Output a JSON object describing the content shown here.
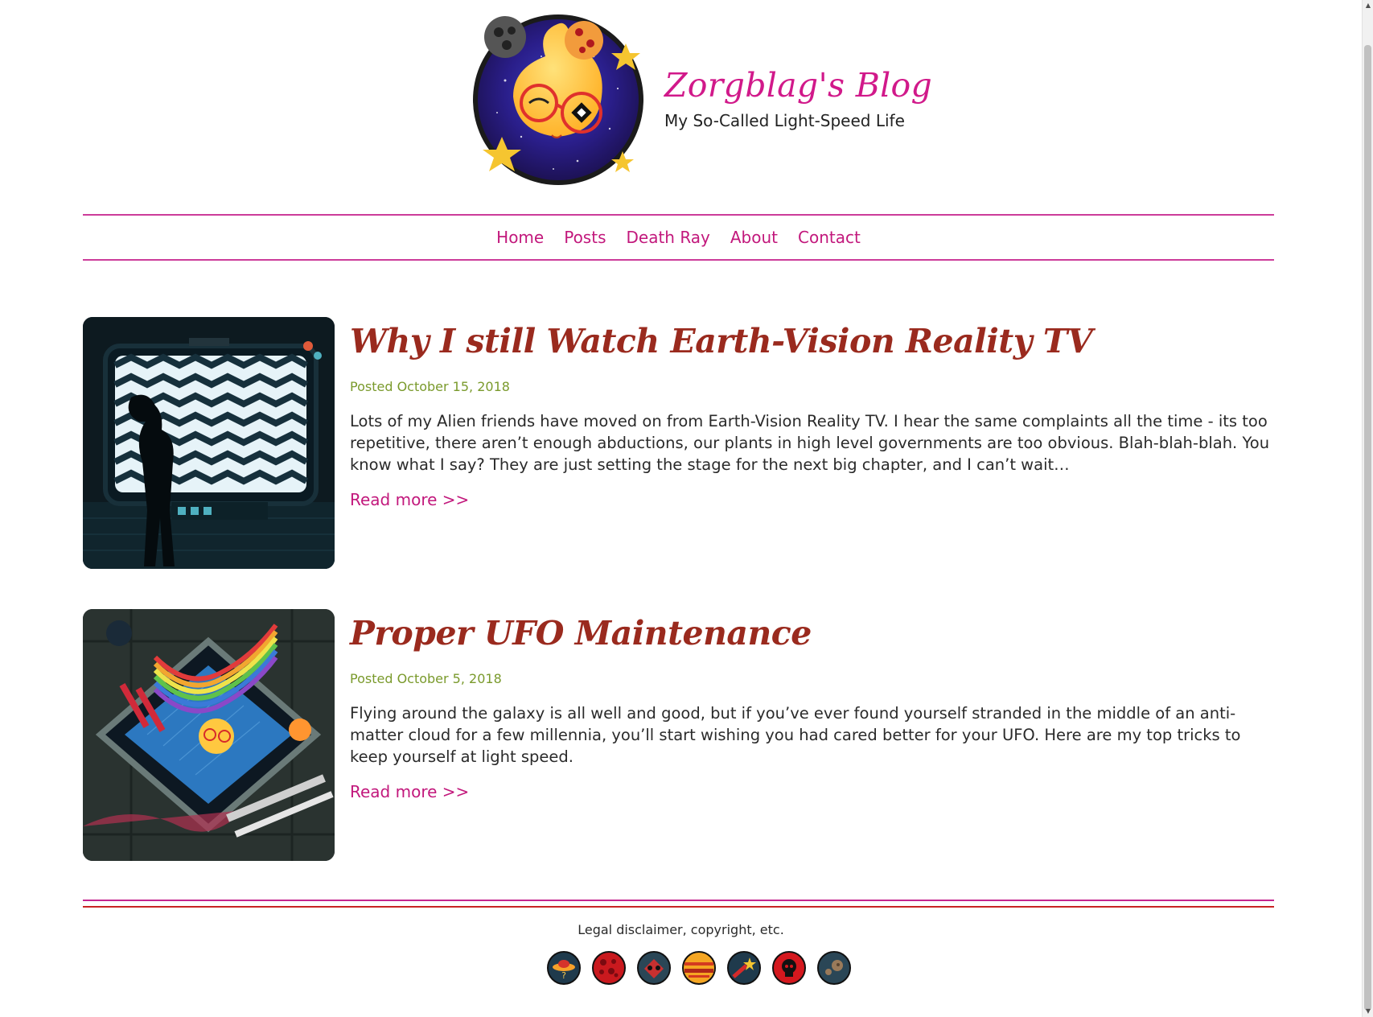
{
  "header": {
    "title": "Zorgblag's Blog",
    "subtitle": "My So-Called Light-Speed Life"
  },
  "nav": {
    "items": [
      "Home",
      "Posts",
      "Death Ray",
      "About",
      "Contact"
    ]
  },
  "posts": [
    {
      "title": "Why I still Watch Earth-Vision Reality TV",
      "date": "Posted October 15, 2018",
      "excerpt": "Lots of my Alien friends have moved on from Earth-Vision Reality TV. I hear the same complaints all the time - its too repetitive, there aren’t enough abductions, our plants in high level governments are too obvious. Blah-blah-blah. You know what I say? They are just setting the stage for the next big chapter, and I can’t wait…",
      "read_more": "Read more >>",
      "image_icon": "tv-watching-illustration"
    },
    {
      "title": "Proper UFO Maintenance",
      "date": "Posted October 5, 2018",
      "excerpt": "Flying around the galaxy is all well and good, but if you’ve ever found yourself stranded in the middle of an anti-matter cloud for a few millennia, you’ll start wishing you had cared better for your UFO. Here are my top tricks to keep yourself at light speed.",
      "read_more": "Read more >>",
      "image_icon": "ufo-maintenance-illustration"
    }
  ],
  "footer": {
    "text": "Legal disclaimer, copyright, etc.",
    "social_icons": [
      "ufo-icon",
      "planet-icon",
      "alien-face-icon",
      "gas-giant-icon",
      "shooting-star-icon",
      "skull-icon",
      "asteroid-icon"
    ]
  },
  "colors": {
    "accent": "#c2187c",
    "title": "#9a2a1e",
    "date": "#7a9a2c",
    "rule_pink": "#c4268f",
    "rule_red": "#c82424"
  }
}
